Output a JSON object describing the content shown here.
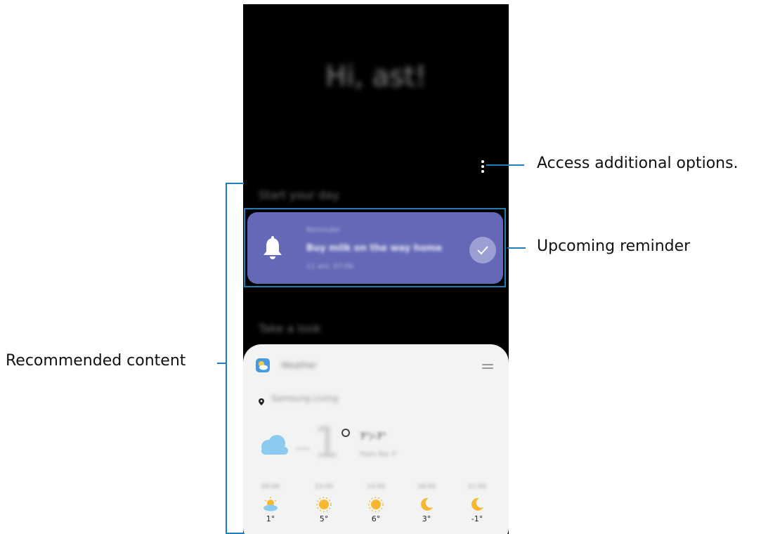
{
  "home": {
    "greeting": "Hi, ast!",
    "section_start": "Start your day",
    "section_look": "Take a look"
  },
  "reminder": {
    "category": "Reminder",
    "title": "Buy milk on the way home",
    "time": "11 am, 07:00"
  },
  "weather": {
    "app_name": "Weather",
    "location": "Samsung Living",
    "current_temp": "1",
    "high_low": "7°/-7°",
    "feels_like": "Feels like 3°",
    "forecast": [
      {
        "time": "09:00",
        "icon": "partly-cloudy-icon",
        "temp": "1°"
      },
      {
        "time": "12:00",
        "icon": "sun-icon",
        "temp": "5°"
      },
      {
        "time": "15:00",
        "icon": "sun-icon",
        "temp": "6°"
      },
      {
        "time": "18:00",
        "icon": "moon-icon",
        "temp": "3°"
      },
      {
        "time": "21:00",
        "icon": "moon-icon",
        "temp": "-1°"
      }
    ]
  },
  "callouts": {
    "options": "Access additional options.",
    "reminder": "Upcoming reminder",
    "recommended": "Recommended content"
  },
  "colors": {
    "reminder_card": "#6469b7",
    "callout_line": "#1e7eb8",
    "sun": "#f7b731",
    "cloud": "#8ccbef"
  }
}
